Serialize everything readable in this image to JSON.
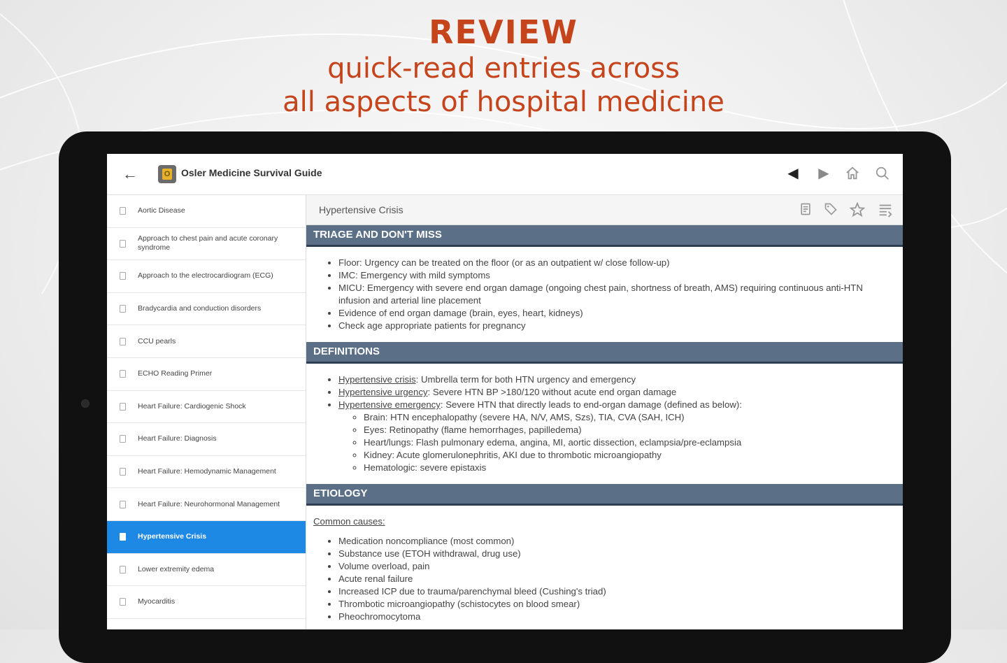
{
  "promo": {
    "headline": "REVIEW",
    "line1": "quick-read entries across",
    "line2": "all aspects of hospital medicine"
  },
  "app": {
    "title": "Osler Medicine Survival Guide",
    "logo_letter": "O",
    "icons": [
      "back-arrow-icon",
      "prev-arrow-icon",
      "next-arrow-icon",
      "home-icon",
      "search-icon"
    ]
  },
  "sidebar": {
    "items": [
      {
        "label": "Aortic Disease",
        "active": false
      },
      {
        "label": "Approach to chest pain and acute coronary syndrome",
        "active": false
      },
      {
        "label": "Approach to the electrocardiogram (ECG)",
        "active": false
      },
      {
        "label": "Bradycardia and conduction disorders",
        "active": false
      },
      {
        "label": "CCU pearls",
        "active": false
      },
      {
        "label": "ECHO Reading Primer",
        "active": false
      },
      {
        "label": "Heart Failure: Cardiogenic Shock",
        "active": false
      },
      {
        "label": "Heart Failure: Diagnosis",
        "active": false
      },
      {
        "label": "Heart Failure: Hemodynamic Management",
        "active": false
      },
      {
        "label": "Heart Failure: Neurohormonal Management",
        "active": false
      },
      {
        "label": "Hypertensive Crisis",
        "active": true
      },
      {
        "label": "Lower extremity edema",
        "active": false
      },
      {
        "label": "Myocarditis",
        "active": false
      }
    ]
  },
  "content": {
    "title": "Hypertensive Crisis",
    "triage": {
      "heading": "TRIAGE AND DON'T MISS",
      "items": [
        "Floor: Urgency can be treated on the floor (or as an outpatient w/ close follow-up)",
        "IMC: Emergency with mild symptoms",
        "MICU: Emergency with severe end organ damage (ongoing chest pain, shortness of breath, AMS) requiring continuous anti-HTN infusion and arterial line placement",
        "Evidence of end organ damage (brain, eyes, heart, kidneys)",
        "Check age appropriate patients for pregnancy"
      ]
    },
    "definitions": {
      "heading": "DEFINITIONS",
      "items": [
        {
          "term": "Hypertensive crisis",
          "text": ": Umbrella term for both HTN urgency and emergency"
        },
        {
          "term": "Hypertensive urgency",
          "text": ": Severe HTN BP >180/120 without acute end organ damage"
        },
        {
          "term": "Hypertensive emergency",
          "text": ": Severe HTN that directly leads to end-organ damage (defined as below):"
        }
      ],
      "subitems": [
        "Brain: HTN encephalopathy (severe HA, N/V, AMS, Szs), TIA, CVA (SAH, ICH)",
        "Eyes: Retinopathy (flame hemorrhages, papilledema)",
        "Heart/lungs: Flash pulmonary edema, angina, MI, aortic dissection, eclampsia/pre-eclampsia",
        "Kidney: Acute glomerulonephritis, AKI due to thrombotic microangiopathy",
        "Hematologic: severe epistaxis"
      ]
    },
    "etiology": {
      "heading": "ETIOLOGY",
      "causes_label": "Common causes:",
      "items": [
        "Medication noncompliance (most common)",
        "Substance use (ETOH withdrawal, drug use)",
        "Volume overload, pain",
        "Acute renal failure",
        "Increased ICP due to trauma/parenchymal bleed (Cushing's triad)",
        "Thrombotic microangiopathy (schistocytes on blood smear)",
        "Pheochromocytoma"
      ]
    }
  },
  "colors": {
    "promo_text": "#c5441c",
    "section_bar": "#5b6f86",
    "active_item": "#1e88e5"
  }
}
